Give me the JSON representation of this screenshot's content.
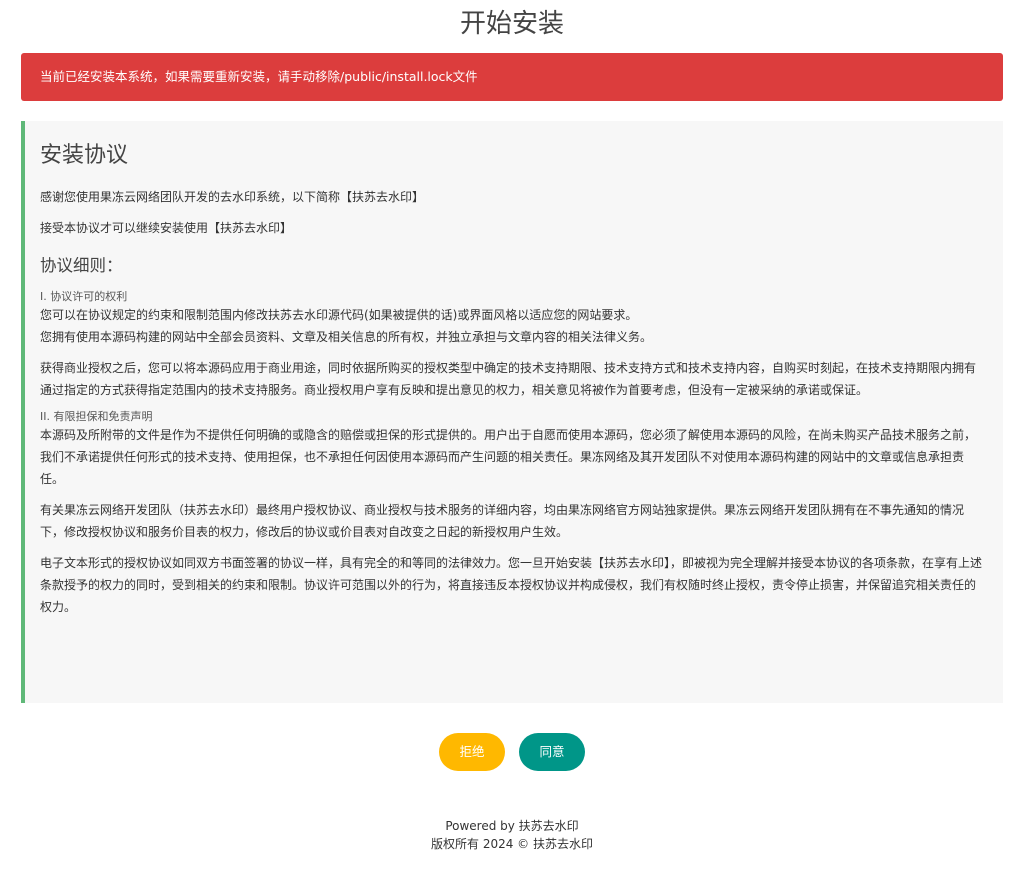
{
  "header": {
    "title": "开始安装"
  },
  "alert": {
    "message": "当前已经安装本系统，如果需要重新安装，请手动移除/public/install.lock文件",
    "color": "#dc3d3d"
  },
  "agreement": {
    "title": "安装协议",
    "intro_1": "感谢您使用果冻云网络团队开发的去水印系统，以下简称【扶苏去水印】",
    "intro_2": "接受本协议才可以继续安装使用【扶苏去水印】",
    "terms_heading": "协议细则：",
    "section_1": {
      "label": "I. 协议许可的权利",
      "lines": [
        "您可以在协议规定的约束和限制范围内修改扶苏去水印源代码(如果被提供的话)或界面风格以适应您的网站要求。",
        "您拥有使用本源码构建的网站中全部会员资料、文章及相关信息的所有权，并独立承担与文章内容的相关法律义务。"
      ],
      "paragraph": "获得商业授权之后，您可以将本源码应用于商业用途，同时依据所购买的授权类型中确定的技术支持期限、技术支持方式和技术支持内容，自购买时刻起，在技术支持期限内拥有通过指定的方式获得指定范围内的技术支持服务。商业授权用户享有反映和提出意见的权力，相关意见将被作为首要考虑，但没有一定被采纳的承诺或保证。"
    },
    "section_2": {
      "label": "II. 有限担保和免责声明",
      "paragraph_1": "本源码及所附带的文件是作为不提供任何明确的或隐含的赔偿或担保的形式提供的。用户出于自愿而使用本源码，您必须了解使用本源码的风险，在尚未购买产品技术服务之前，我们不承诺提供任何形式的技术支持、使用担保，也不承担任何因使用本源码而产生问题的相关责任。果冻网络及其开发团队不对使用本源码构建的网站中的文章或信息承担责任。",
      "paragraph_2": "有关果冻云网络开发团队（扶苏去水印）最终用户授权协议、商业授权与技术服务的详细内容，均由果冻网络官方网站独家提供。果冻云网络开发团队拥有在不事先通知的情况下，修改授权协议和服务价目表的权力，修改后的协议或价目表对自改变之日起的新授权用户生效。",
      "paragraph_3": "电子文本形式的授权协议如同双方书面签署的协议一样，具有完全的和等同的法律效力。您一旦开始安装【扶苏去水印】，即被视为完全理解并接受本协议的各项条款，在享有上述条款授予的权力的同时，受到相关的约束和限制。协议许可范围以外的行为，将直接违反本授权协议并构成侵权，我们有权随时终止授权，责令停止损害，并保留追究相关责任的权力。"
    },
    "accent_color": "#5fb878"
  },
  "actions": {
    "reject_label": "拒绝",
    "agree_label": "同意",
    "reject_color": "#ffb800",
    "agree_color": "#009688"
  },
  "footer": {
    "powered_by": "Powered by 扶苏去水印",
    "copyright": "版权所有 2024 © 扶苏去水印"
  }
}
